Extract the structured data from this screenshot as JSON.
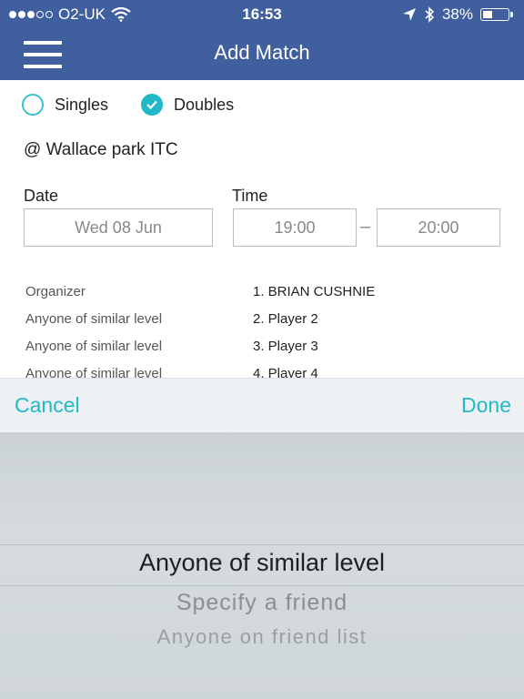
{
  "status_bar": {
    "carrier": "O2-UK",
    "time": "16:53",
    "battery_percent": "38%",
    "battery_level": 0.38,
    "signal_dots_filled": 3,
    "signal_dots_total": 5,
    "icons": [
      "wifi-icon",
      "location-arrow-icon",
      "bluetooth-icon",
      "battery-icon"
    ]
  },
  "nav": {
    "title": "Add Match",
    "menu_icon": "hamburger-icon"
  },
  "match_type": {
    "options": [
      {
        "label": "Singles",
        "checked": false
      },
      {
        "label": "Doubles",
        "checked": true
      }
    ]
  },
  "location": "@ Wallace park ITC",
  "date": {
    "label": "Date",
    "value": "Wed 08 Jun"
  },
  "time": {
    "label": "Time",
    "start": "19:00",
    "end": "20:00"
  },
  "players": {
    "roles": [
      "Organizer",
      "Anyone of similar level",
      "Anyone of similar level",
      "Anyone of similar level"
    ],
    "names": [
      "1. BRIAN CUSHNIE",
      "2. Player 2",
      "3. Player 3",
      "4. Player 4"
    ]
  },
  "picker_toolbar": {
    "cancel": "Cancel",
    "done": "Done"
  },
  "picker": {
    "selected": "Anyone of similar level",
    "options": [
      "Specify a friend",
      "Anyone on friend list"
    ]
  },
  "colors": {
    "nav_bg": "#3f5f9e",
    "accent": "#22b9c6"
  }
}
